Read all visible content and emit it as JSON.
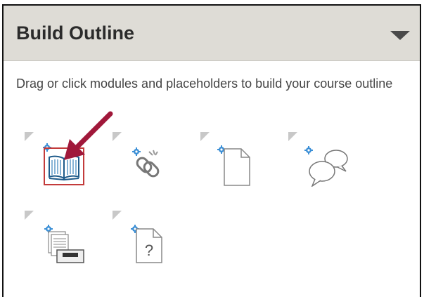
{
  "header": {
    "title": "Build Outline",
    "toggle_icon": "caret-down-icon"
  },
  "instructions": "Drag or click modules and placeholders to build your course outline",
  "tools": [
    {
      "icon": "book-icon",
      "selected": true
    },
    {
      "icon": "link-icon",
      "selected": false
    },
    {
      "icon": "file-icon",
      "selected": false
    },
    {
      "icon": "discussion-icon",
      "selected": false
    },
    {
      "icon": "document-stack-icon",
      "selected": false
    },
    {
      "icon": "quiz-icon",
      "selected": false
    }
  ],
  "colors": {
    "header_bg": "#dedcd6",
    "accent_gear": "#3b8fd6",
    "highlight": "#c33b3b",
    "arrow": "#a0183a"
  }
}
